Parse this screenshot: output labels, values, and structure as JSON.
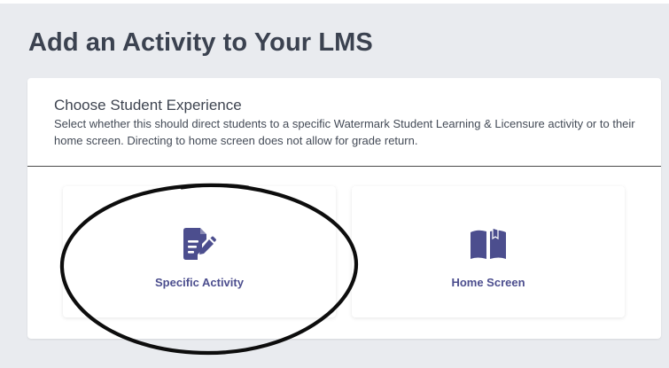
{
  "page": {
    "title": "Add an Activity to Your LMS"
  },
  "experience": {
    "heading": "Choose Student Experience",
    "description": "Select whether this should direct students to a specific Watermark Student Learning & Licensure activity or to their home screen. Directing to home screen does not allow for grade return."
  },
  "options": [
    {
      "label": "Specific Activity",
      "icon": "document-edit-icon"
    },
    {
      "label": "Home Screen",
      "icon": "open-book-icon"
    }
  ],
  "colors": {
    "accent": "#4c4e8e",
    "page_background": "#e9ebef",
    "title_text": "#3b4250"
  }
}
